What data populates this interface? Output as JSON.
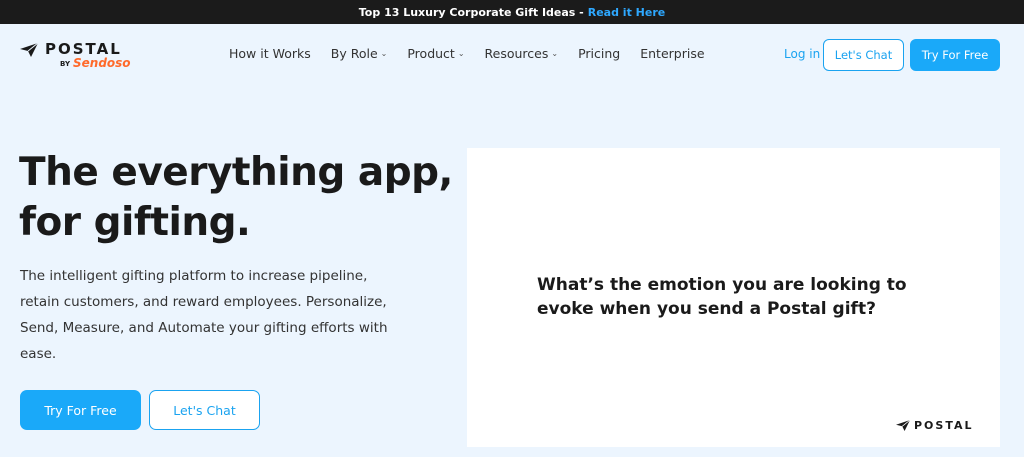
{
  "announcement": {
    "text": "Top 13 Luxury Corporate Gift Ideas -",
    "link": "Read it Here"
  },
  "logo": {
    "name": "POSTAL",
    "by": "BY",
    "partner": "Sendoso"
  },
  "nav": {
    "items": [
      {
        "label": "How it Works",
        "has_menu": false
      },
      {
        "label": "By Role",
        "has_menu": true
      },
      {
        "label": "Product",
        "has_menu": true
      },
      {
        "label": "Resources",
        "has_menu": true
      },
      {
        "label": "Pricing",
        "has_menu": false
      },
      {
        "label": "Enterprise",
        "has_menu": false
      }
    ],
    "login": "Log in",
    "chat": "Let's Chat",
    "try": "Try For Free"
  },
  "hero": {
    "title_line1": "The everything app,",
    "title_line2": "for gifting.",
    "description": "The intelligent gifting platform to increase pipeline, retain customers, and reward employees. Personalize, Send, Measure, and Automate your gifting efforts with ease.",
    "try_button": "Try For Free",
    "chat_button": "Let's Chat"
  },
  "video": {
    "question_line1": "What’s the emotion you are looking to",
    "question_line2": "evoke when you send a Postal gift?",
    "brand": "POSTAL"
  },
  "colors": {
    "accent": "#1aa9f9",
    "background": "#ecf5fe",
    "topbar": "#1b1b1b",
    "sendoso": "#ff6a2b"
  }
}
